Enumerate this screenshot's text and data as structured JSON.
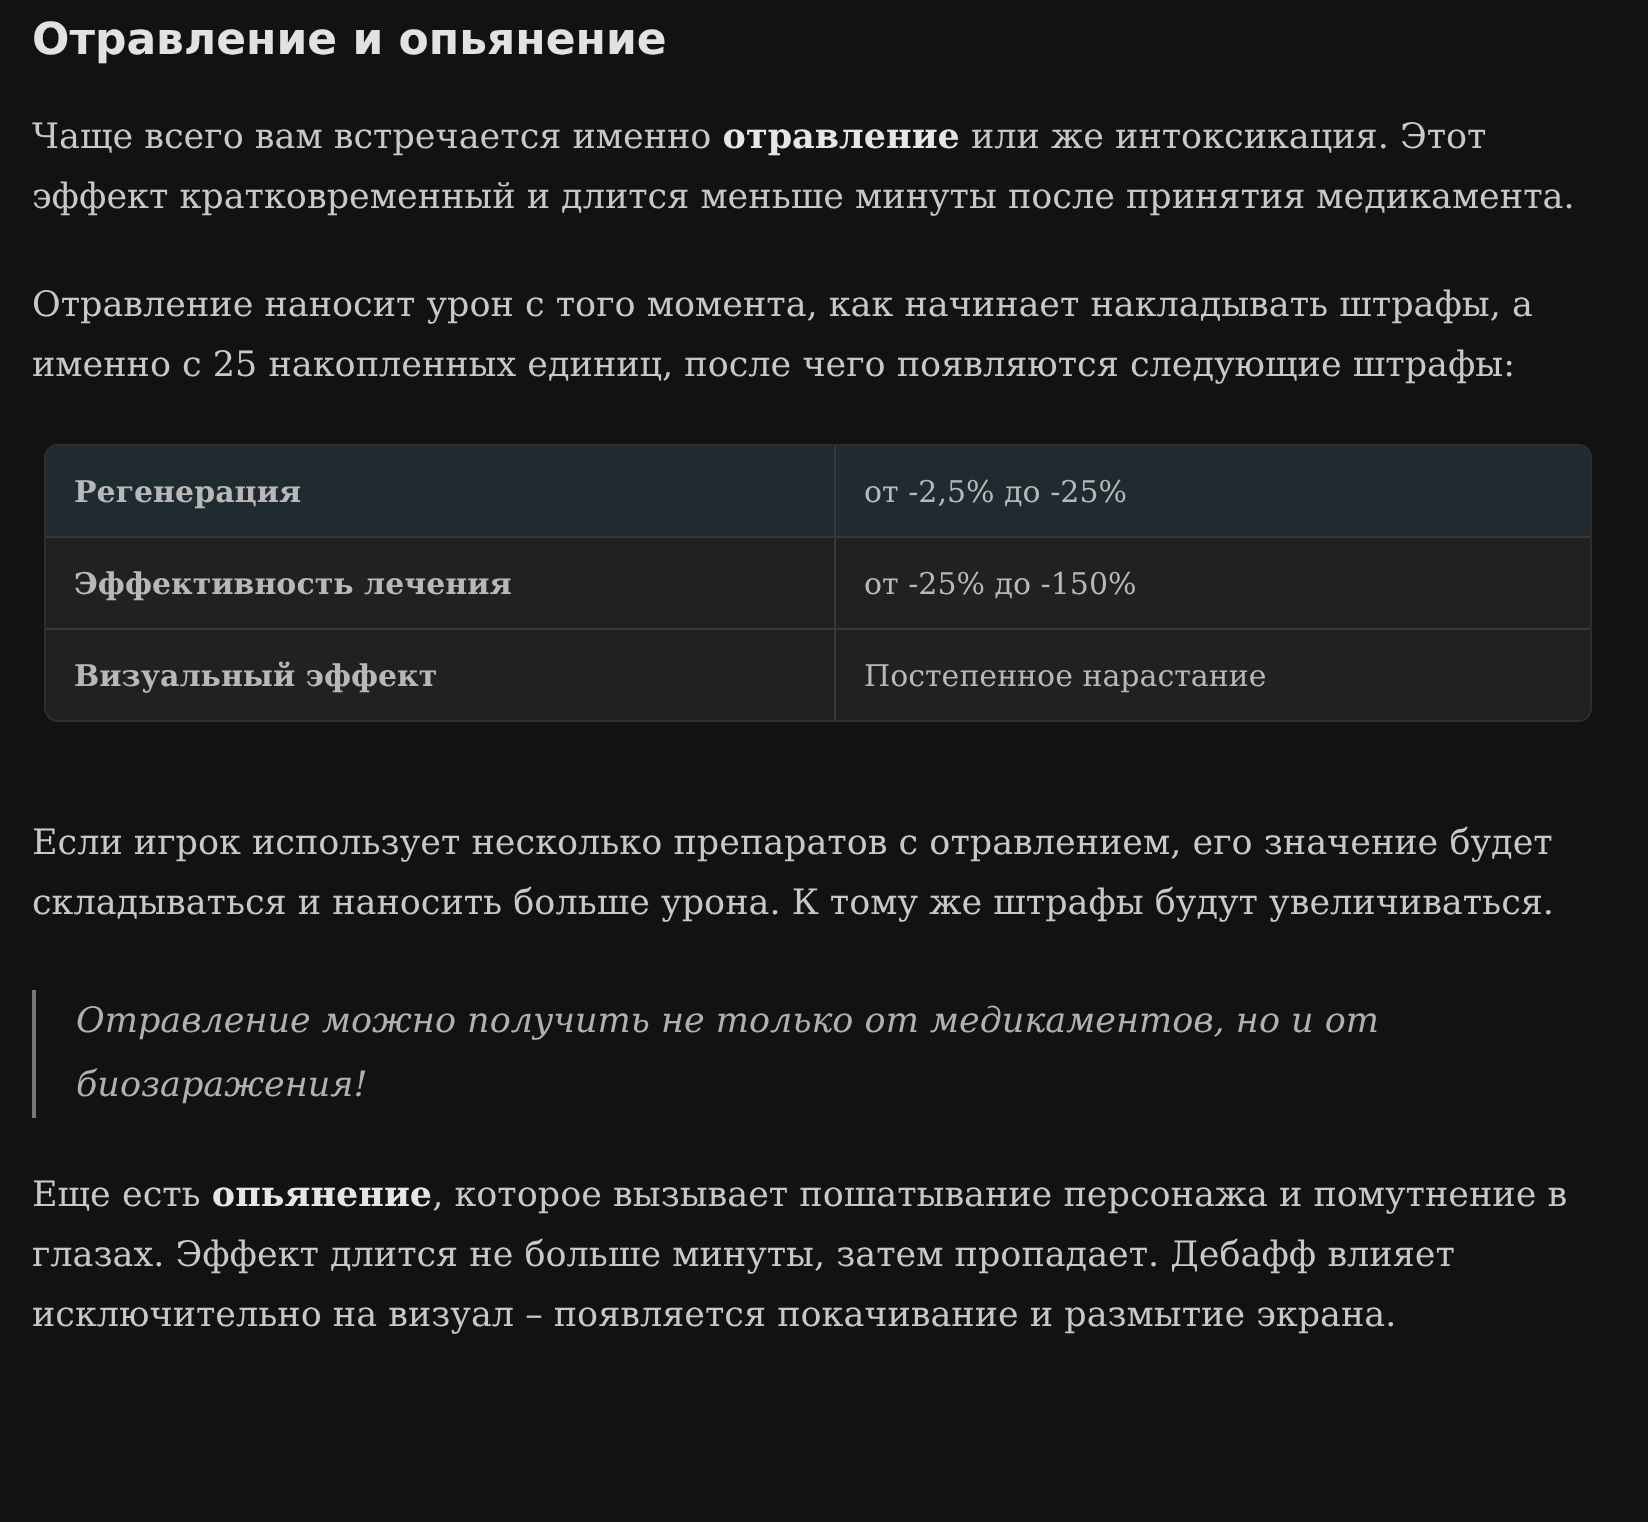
{
  "heading": "Отравление и опьянение",
  "paragraphs_before": [
    "Чаще всего вам встречается именно **отравление** или же интоксикация. Этот эффект кратковременный и длится меньше минуты после принятия медикамента.",
    "Отравление наносит урон с того момента, как начинает накладывать штрафы, а именно с 25 накопленных единиц, после чего появляются следующие штрафы:"
  ],
  "table": {
    "rows": [
      {
        "label": "Регенерация",
        "value": "от -2,5% до -25%",
        "highlighted": true
      },
      {
        "label": "Эффективность лечения",
        "value": "от -25% до -150%",
        "highlighted": false
      },
      {
        "label": "Визуальный эффект",
        "value": "Постепенное нарастание",
        "highlighted": false
      }
    ]
  },
  "paragraph_after": "Если игрок использует несколько препаратов с отравлением, его значение будет складываться и наносить больше урона. К тому же штрафы будут увеличиваться.",
  "quote": "Отравление можно получить не только от медикаментов, но и от биозаражения!",
  "paragraph_last": "Еще есть **опьянение**, которое вызывает пошатывание персонажа и помутнение в глазах. Эффект длится не больше минуты, затем пропадает. Дебафф влияет исключительно на визуал – появляется покачивание и размытие экрана."
}
